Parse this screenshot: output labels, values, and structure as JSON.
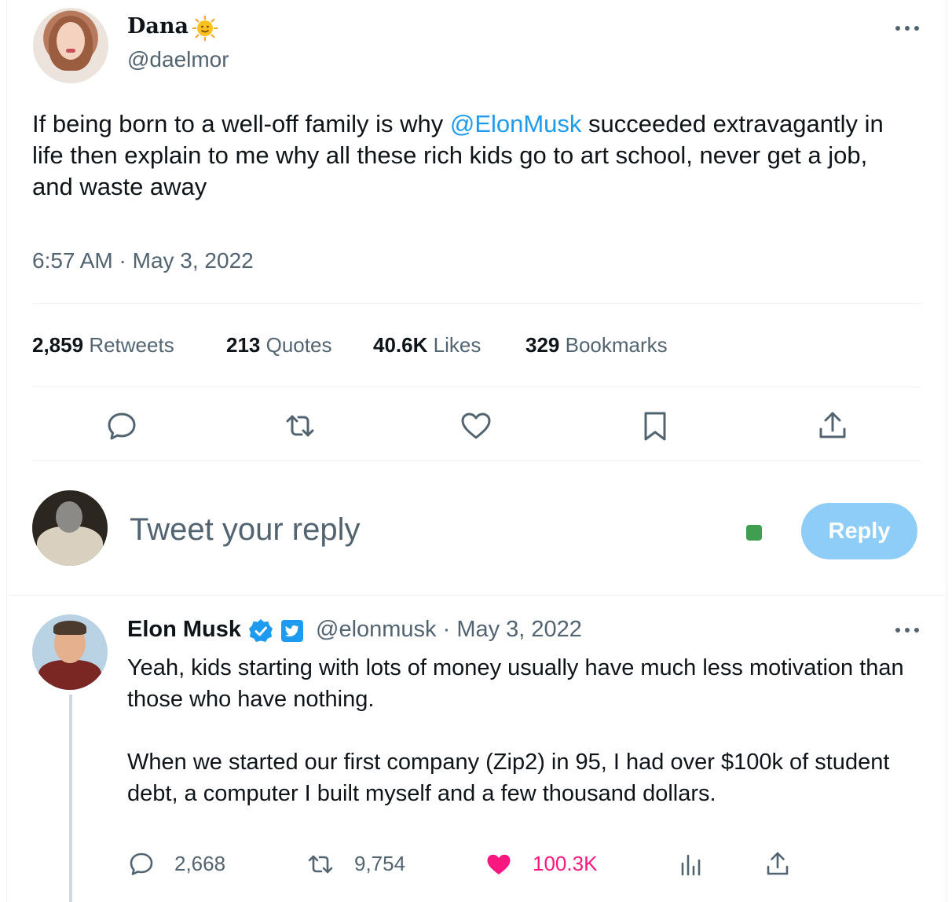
{
  "main_tweet": {
    "author_name": "Dana",
    "author_emoji": "sun-with-face",
    "author_handle": "@daelmor",
    "text_before": "If being born to a well-off family is why ",
    "mention": "@ElonMusk",
    "text_after": " succeeded extravagantly in life then explain to me why all these rich kids go to art school, never get a job, and waste away",
    "timestamp": "6:57 AM · May 3, 2022",
    "stats": {
      "retweets_count": "2,859",
      "retweets_label": "Retweets",
      "quotes_count": "213",
      "quotes_label": "Quotes",
      "likes_count": "40.6K",
      "likes_label": "Likes",
      "bookmarks_count": "329",
      "bookmarks_label": "Bookmarks"
    },
    "actions": [
      "reply-icon",
      "retweet-icon",
      "like-icon",
      "bookmark-icon",
      "share-icon"
    ]
  },
  "composer": {
    "placeholder": "Tweet your reply",
    "button_label": "Reply"
  },
  "reply_tweet": {
    "author_name": "Elon Musk",
    "author_handle": "@elonmusk",
    "date": "May 3, 2022",
    "handle_date": "@elonmusk · May 3, 2022",
    "paragraph_1": "Yeah, kids starting with lots of money usually have much less motivation than those who have nothing.",
    "paragraph_2": "When we started our first company (Zip2) in 95, I had over $100k of student debt, a computer I built myself and a few thousand dollars.",
    "replies_count": "2,668",
    "retweets_count": "9,754",
    "likes_count": "100.3K"
  },
  "colors": {
    "accent": "#1d9bf0",
    "secondary_text": "#536471",
    "like_pink": "#f91880",
    "reply_button": "#8ecdf7"
  }
}
